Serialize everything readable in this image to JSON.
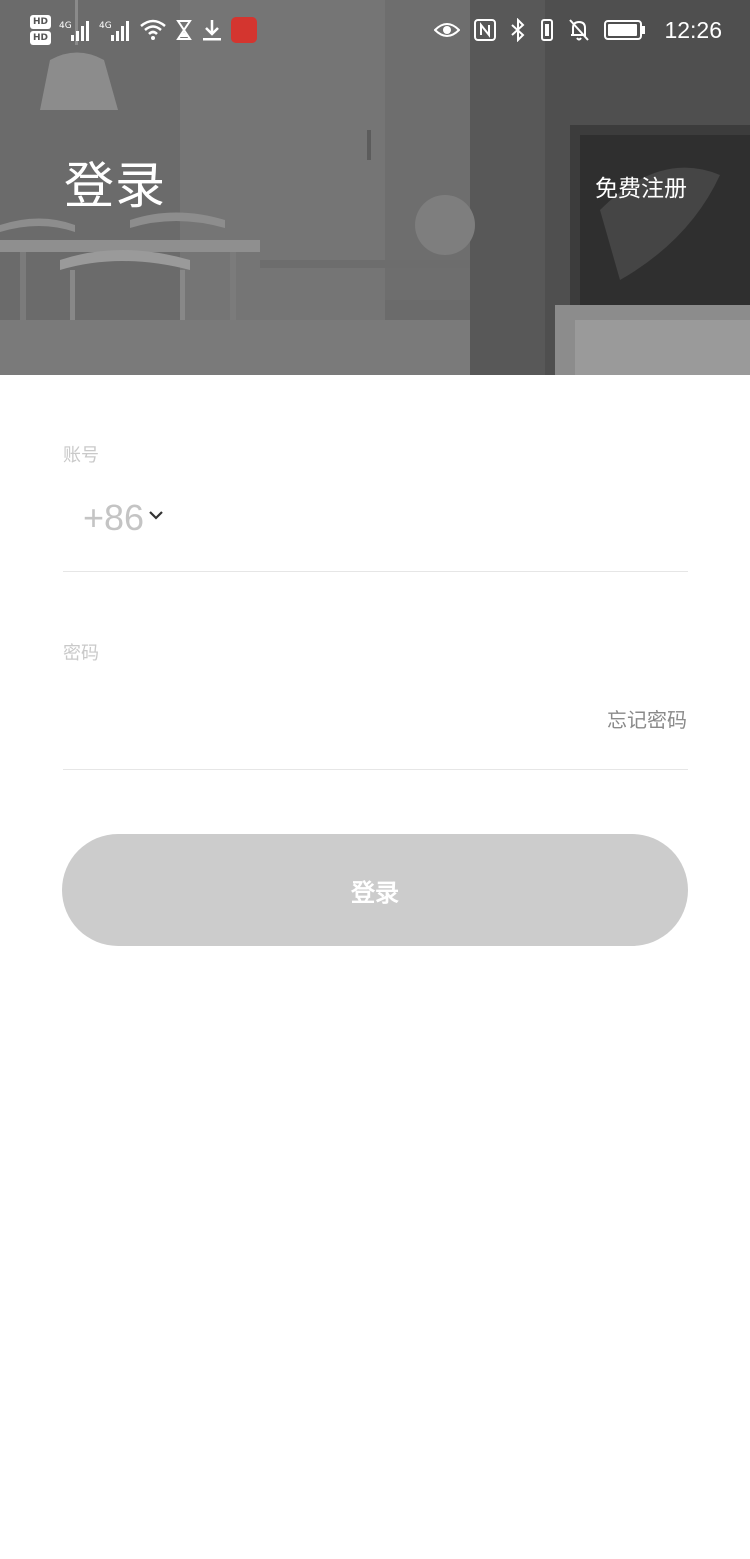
{
  "status_bar": {
    "sim1_tag": "HD",
    "sim2_tag": "HD",
    "network1": "4G",
    "network2": "4G",
    "time": "12:26",
    "icons_left": [
      "hd-sim-icon",
      "signal-4g-icon",
      "signal-4g-icon",
      "wifi-icon",
      "hourglass-icon",
      "download-icon",
      "app-notification-icon"
    ],
    "icons_right": [
      "eye-comfort-icon",
      "nfc-icon",
      "bluetooth-icon",
      "vibrate-icon",
      "mute-bell-icon",
      "battery-icon"
    ]
  },
  "header": {
    "title": "登录",
    "register_link": "免费注册"
  },
  "form": {
    "account_label": "账号",
    "country_code": "+86",
    "account_value": "",
    "password_label": "密码",
    "password_value": "",
    "forgot_password": "忘记密码",
    "login_button": "登录"
  },
  "colors": {
    "button_disabled": "#cccccc",
    "label_gray": "#c9c9c9",
    "divider": "#e6e6e6",
    "header_overlay": "#6a6a6a"
  }
}
